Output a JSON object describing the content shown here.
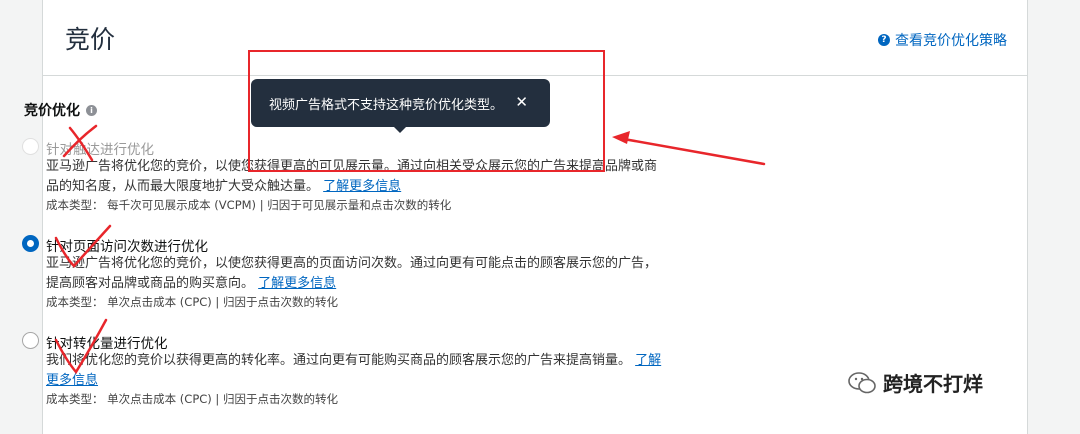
{
  "header": {
    "title": "竞价",
    "strategy_link": "查看竞价优化策略"
  },
  "section": {
    "title": "竞价优化"
  },
  "tooltip": {
    "text": "视频广告格式不支持这种竞价优化类型。",
    "close": "✕"
  },
  "options": [
    {
      "label": "针对触达进行优化",
      "desc": "亚马逊广告将优化您的竞价，以使您获得更高的可见展示量。通过向相关受众展示您的广告来提高品牌或商品的知名度，从而最大限度地扩大受众触达量。",
      "link": "了解更多信息",
      "meta": "成本类型： 每千次可见展示成本 (VCPM) | 归因于可见展示量和点击次数的转化",
      "state": "disabled"
    },
    {
      "label": "针对页面访问次数进行优化",
      "desc": "亚马逊广告将优化您的竞价，以使您获得更高的页面访问次数。通过向更有可能点击的顾客展示您的广告，提高顾客对品牌或商品的购买意向。",
      "link": "了解更多信息",
      "meta": "成本类型： 单次点击成本 (CPC) | 归因于点击次数的转化",
      "state": "checked"
    },
    {
      "label": "针对转化量进行优化",
      "desc": "我们将优化您的竞价以获得更高的转化率。通过向更有可能购买商品的顾客展示您的广告来提高销量。",
      "link": "了解更多信息",
      "meta": "成本类型： 单次点击成本 (CPC) | 归因于点击次数的转化",
      "state": "unchecked"
    }
  ],
  "watermark": {
    "text": "跨境不打烊",
    "icon": "wechat-icon"
  },
  "colors": {
    "accent": "#0066c0",
    "annotation": "#e8262b",
    "tooltip_bg": "#232f3e"
  }
}
